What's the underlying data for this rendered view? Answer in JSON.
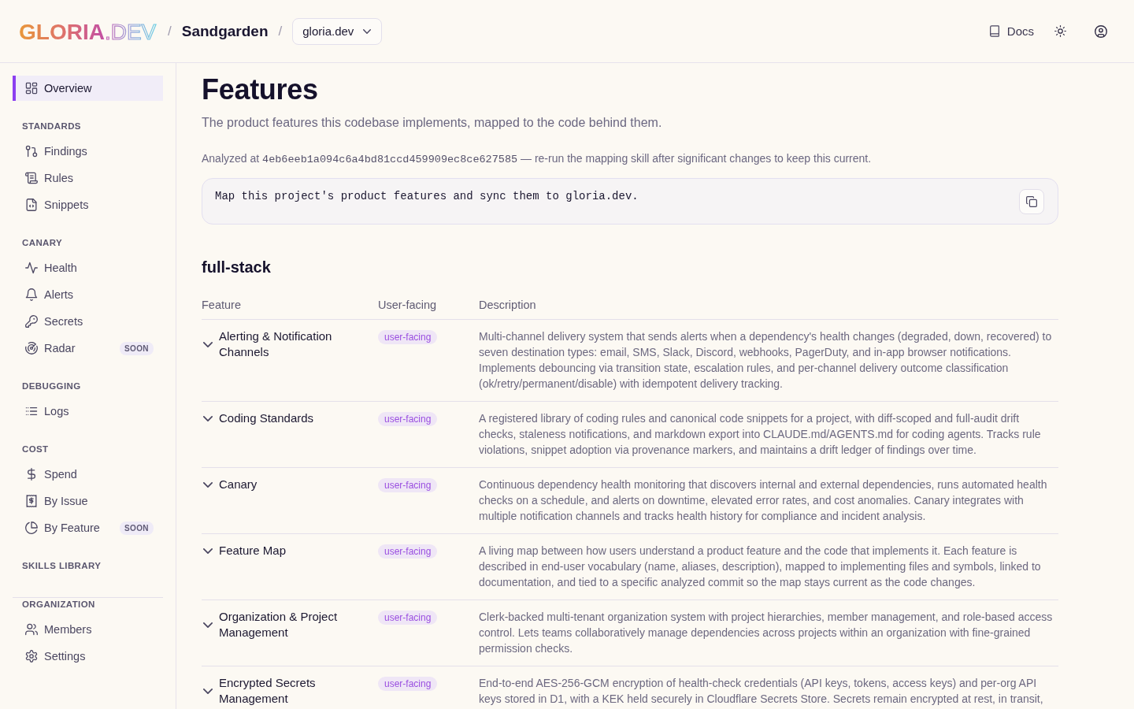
{
  "header": {
    "logo": {
      "name": "GLORIA",
      "suffix": ".DEV"
    },
    "breadcrumb": [
      {
        "kind": "project",
        "separator": "/",
        "label": "Sandgarden"
      },
      {
        "kind": "select",
        "separator": "/",
        "value": "gloria.dev"
      }
    ],
    "docs_link": "Docs"
  },
  "sidebar": {
    "sections": [
      {
        "items": [
          {
            "label": "Overview",
            "selected": true
          }
        ]
      },
      {
        "heading": "STANDARDS",
        "items": [
          {
            "label": "Findings",
            "selected": false
          },
          {
            "label": "Rules",
            "selected": false
          },
          {
            "label": "Snippets",
            "selected": false
          }
        ]
      },
      {
        "heading": "CANARY",
        "items": [
          {
            "label": "Health",
            "selected": false
          },
          {
            "label": "Alerts",
            "selected": false
          },
          {
            "label": "Secrets",
            "selected": false
          },
          {
            "label": "Radar",
            "selected": false,
            "badge": "SOON"
          }
        ]
      },
      {
        "heading": "DEBUGGING",
        "items": [
          {
            "label": "Logs",
            "selected": false
          }
        ]
      },
      {
        "heading": "COST",
        "items": [
          {
            "label": "Spend",
            "selected": false
          },
          {
            "label": "By Issue",
            "selected": false
          },
          {
            "label": "By Feature",
            "selected": false,
            "badge": "SOON"
          }
        ]
      },
      {
        "heading": "SKILLS LIBRARY"
      }
    ],
    "bottom_sections": [
      {
        "heading": "ORGANIZATION",
        "items": [
          {
            "label": "Members",
            "selected": false
          },
          {
            "label": "Settings",
            "selected": false
          }
        ]
      }
    ]
  },
  "page": {
    "title": "Features",
    "subtitle": "The product features this codebase implements, mapped to the code behind them.",
    "analysis": {
      "prefix": "Analyzed at",
      "commit": "4eb6eeb1a094c6a4bd81ccd459909ec8ce627585",
      "suffix": "— re-run the mapping skill after significant changes to keep this current."
    },
    "prompt": {
      "text": "Map this project's product features and sync them to gloria.dev."
    },
    "groups": [
      {
        "heading": "full-stack",
        "columns": [
          "Feature",
          "User-facing",
          "Description"
        ],
        "rows": [
          {
            "feature": "Alerting & Notification Channels",
            "tag": "user-facing",
            "description": "Multi-channel delivery system that sends alerts when a dependency's health changes (degraded, down, recovered) to seven destination types: email, SMS, Slack, Discord, webhooks, PagerDuty, and in-app browser notifications. Implements debouncing via transition state, escalation rules, and per-channel delivery outcome classification (ok/retry/permanent/disable) with idempotent delivery tracking."
          },
          {
            "feature": "Coding Standards",
            "tag": "user-facing",
            "description": "A registered library of coding rules and canonical code snippets for a project, with diff-scoped and full-audit drift checks, staleness notifications, and markdown export into CLAUDE.md/AGENTS.md for coding agents. Tracks rule violations, snippet adoption via provenance markers, and maintains a drift ledger of findings over time."
          },
          {
            "feature": "Canary",
            "tag": "user-facing",
            "description": "Continuous dependency health monitoring that discovers internal and external dependencies, runs automated health checks on a schedule, and alerts on downtime, elevated error rates, and cost anomalies. Canary integrates with multiple notification channels and tracks health history for compliance and incident analysis."
          },
          {
            "feature": "Feature Map",
            "tag": "user-facing",
            "description": "A living map between how users understand a product feature and the code that implements it. Each feature is described in end-user vocabulary (name, aliases, description), mapped to implementing files and symbols, linked to documentation, and tied to a specific analyzed commit so the map stays current as the code changes."
          },
          {
            "feature": "Organization & Project Management",
            "tag": "user-facing",
            "description": "Clerk-backed multi-tenant organization system with project hierarchies, member management, and role-based access control. Lets teams collaboratively manage dependencies across projects within an organization with fine-grained permission checks."
          },
          {
            "feature": "Encrypted Secrets Management",
            "tag": "user-facing",
            "description": "End-to-end AES-256-GCM encryption of health-check credentials (API keys, tokens, access keys) and per-org API keys stored in D1, with a KEK held securely in Cloudflare Secrets Store. Secrets remain encrypted at rest, in transit,"
          }
        ]
      }
    ]
  }
}
